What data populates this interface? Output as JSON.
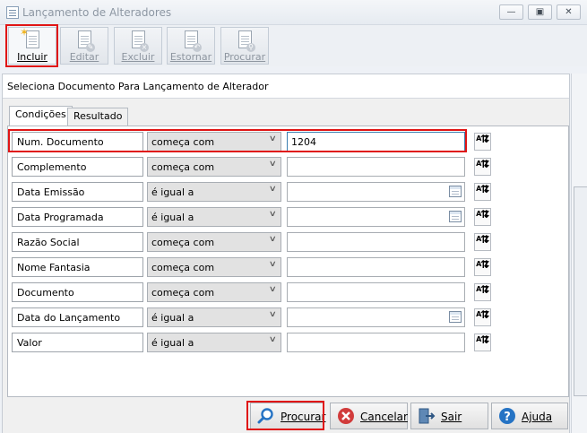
{
  "window": {
    "title": "Lançamento de Alteradores",
    "controls": [
      "minimize-icon",
      "restore-icon",
      "close-icon"
    ]
  },
  "toolbar": {
    "buttons": [
      {
        "label": "Incluir",
        "icon": "new-document-icon",
        "enabled": true
      },
      {
        "label": "Editar",
        "icon": "edit-document-icon",
        "enabled": false
      },
      {
        "label": "Excluir",
        "icon": "delete-document-icon",
        "enabled": false
      },
      {
        "label": "Estornar",
        "icon": "reverse-document-icon",
        "enabled": false
      },
      {
        "label": "Procurar",
        "icon": "search-document-icon",
        "enabled": false
      }
    ]
  },
  "dialog": {
    "title": "Seleciona Documento Para Lançamento de Alterador",
    "tabs": [
      {
        "label": "Condições",
        "active": true
      },
      {
        "label": "Resultado",
        "active": false
      }
    ],
    "conditions": [
      {
        "field": "Num. Documento",
        "operator": "começa com",
        "value": "1204",
        "date_picker": false
      },
      {
        "field": "Complemento",
        "operator": "começa com",
        "value": "",
        "date_picker": false
      },
      {
        "field": "Data Emissão",
        "operator": "é igual a",
        "value": "",
        "date_picker": true
      },
      {
        "field": "Data Programada",
        "operator": "é igual a",
        "value": "",
        "date_picker": true
      },
      {
        "field": "Razão Social",
        "operator": "começa com",
        "value": "",
        "date_picker": false
      },
      {
        "field": "Nome Fantasia",
        "operator": "começa com",
        "value": "",
        "date_picker": false
      },
      {
        "field": "Documento",
        "operator": "começa com",
        "value": "",
        "date_picker": false
      },
      {
        "field": "Data do Lançamento",
        "operator": "é igual a",
        "value": "",
        "date_picker": true
      },
      {
        "field": "Valor",
        "operator": "é igual a",
        "value": "",
        "date_picker": false
      }
    ],
    "sort_icon": "sort-az-icon",
    "sort_icon_text": "A Z",
    "buttons": {
      "search": "Procurar",
      "cancel": "Cancelar",
      "exit": "Sair",
      "help": "Ajuda"
    }
  },
  "colors": {
    "highlight": "#e01515",
    "focus_border": "#3c7fb1",
    "help_blue": "#2573c4",
    "cancel_red": "#d13b3b"
  }
}
